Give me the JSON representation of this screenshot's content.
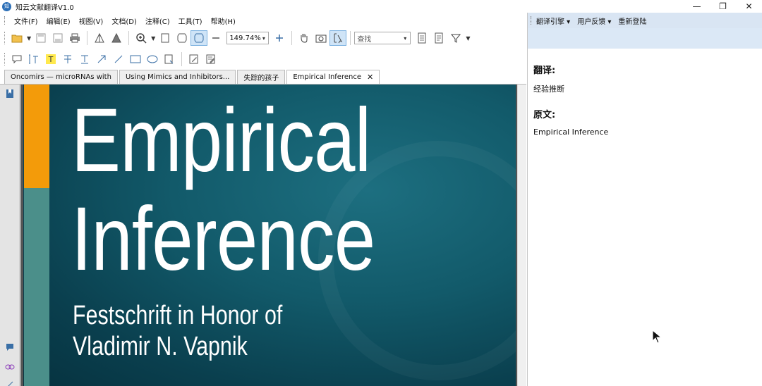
{
  "window": {
    "title": "知云文献翻译V1.0",
    "logo_text": "知",
    "controls": {
      "minimize": "—",
      "restore": "❐",
      "close": "✕"
    }
  },
  "menu": [
    "文件(F)",
    "编辑(E)",
    "视图(V)",
    "文档(D)",
    "注释(C)",
    "工具(T)",
    "帮助(H)"
  ],
  "toolbar": {
    "zoom_value": "149.74%",
    "find_placeholder": "查找"
  },
  "tabs": [
    {
      "label": "Oncomirs — microRNAs with"
    },
    {
      "label": "Using Mimics and Inhibitors..."
    },
    {
      "label": "失踪的孩子"
    },
    {
      "label": "Empirical Inference",
      "close": "✕",
      "active": true
    }
  ],
  "document": {
    "title_line1": "Empirical",
    "title_line2": "Inference",
    "subtitle_line1": "Festschrift in Honor of",
    "subtitle_line2": "Vladimir N. Vapnik"
  },
  "right_panel": {
    "menu": [
      "翻译引擎 ▾",
      "用户反馈 ▾",
      "重新登陆"
    ],
    "translation_heading": "翻译:",
    "translation_text": "经验推断",
    "original_heading": "原文:",
    "original_text": "Empirical Inference"
  }
}
